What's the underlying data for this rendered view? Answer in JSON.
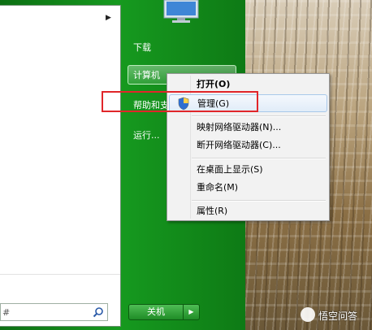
{
  "start_menu": {
    "right_items": {
      "downloads": "下载",
      "computer": "计算机",
      "help": "帮助和支",
      "run": "运行..."
    },
    "search_text": "#",
    "shutdown_label": "关机"
  },
  "context_menu": {
    "items": [
      {
        "label": "打开(O)"
      },
      {
        "label": "管理(G)"
      },
      {
        "label": "映射网络驱动器(N)..."
      },
      {
        "label": "断开网络驱动器(C)..."
      },
      {
        "label": "在桌面上显示(S)"
      },
      {
        "label": "重命名(M)"
      },
      {
        "label": "属性(R)"
      }
    ]
  },
  "watermark": "悟空问答",
  "colors": {
    "highlight": "#e1262a",
    "start_green": "#169a1f"
  }
}
